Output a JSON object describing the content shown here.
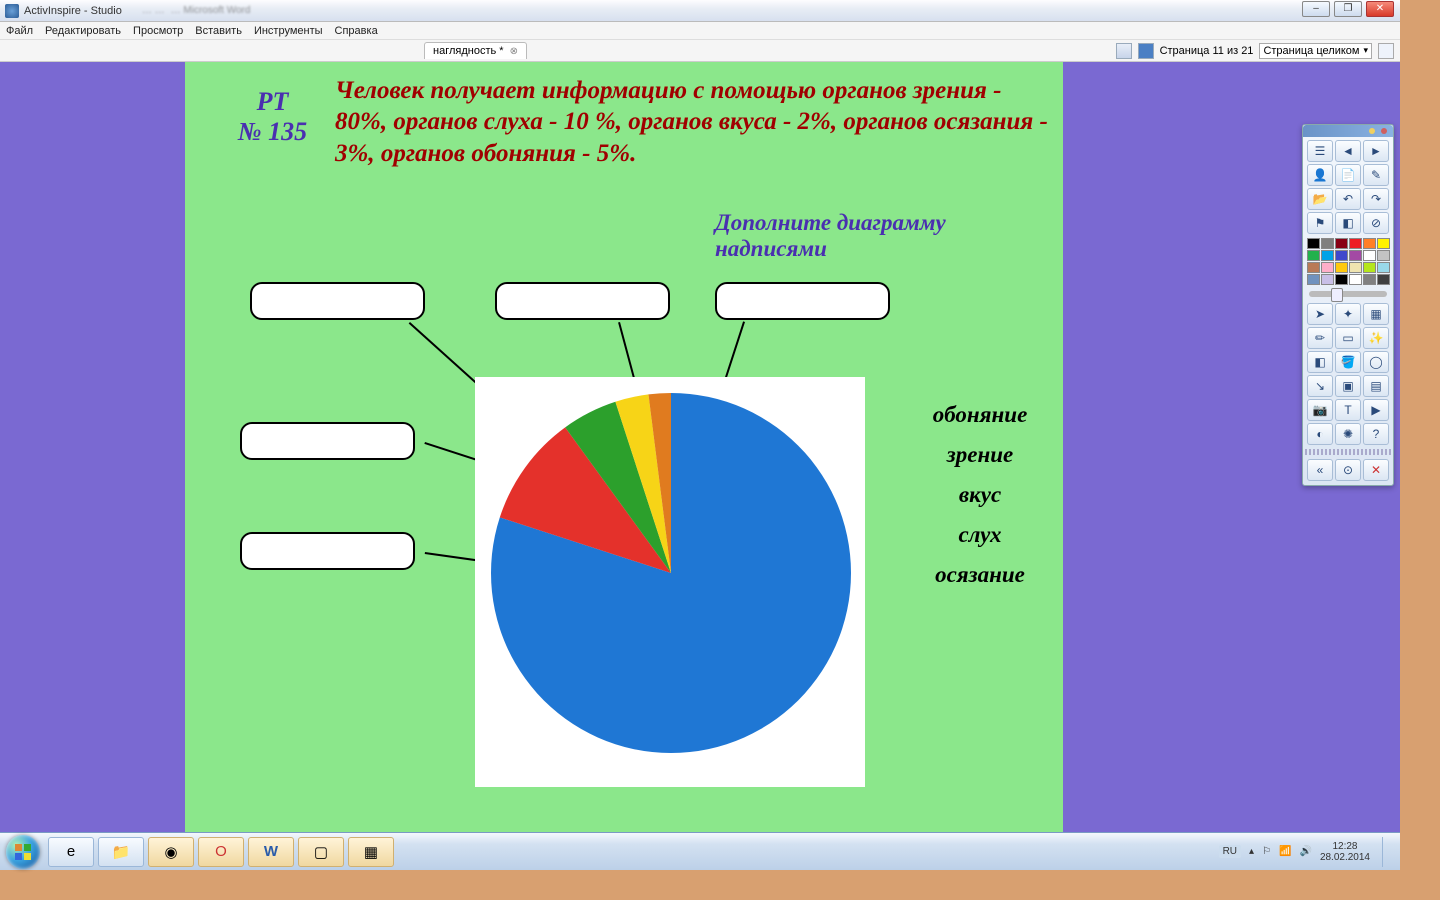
{
  "window": {
    "title": "ActivInspire - Studio",
    "min_label": "–",
    "max_label": "❐",
    "close_label": "✕"
  },
  "menu": {
    "file": "Файл",
    "edit": "Редактировать",
    "view": "Просмотр",
    "insert": "Вставить",
    "tools": "Инструменты",
    "help": "Справка"
  },
  "document": {
    "tab_name": "наглядность *",
    "page_counter": "Страница 11 из 21",
    "zoom_mode": "Страница целиком"
  },
  "slide": {
    "heading_line1": "РТ",
    "heading_line2": "№ 135",
    "body_text": "Человек получает информацию с помощью органов зрения - 80%, органов слуха - 10 %, органов вкуса - 2%, органов осязания - 3%, органов обоняния - 5%.",
    "instruction": "Дополните диаграмму надписями",
    "word_bank": [
      "обоняние",
      "зрение",
      "вкус",
      "слух",
      "осязание"
    ]
  },
  "chart_data": {
    "type": "pie",
    "title": "",
    "categories": [
      "зрение",
      "слух",
      "обоняние",
      "осязание",
      "вкус"
    ],
    "values": [
      80,
      10,
      5,
      3,
      2
    ],
    "colors": [
      "#1f77d4",
      "#e4312b",
      "#2ca02c",
      "#f7d417",
      "#e07b1f"
    ]
  },
  "palette_colors": [
    "#000000",
    "#7f7f7f",
    "#880015",
    "#ed1c24",
    "#ff7f27",
    "#fff200",
    "#22b14c",
    "#00a2e8",
    "#3f48cc",
    "#a349a4",
    "#ffffff",
    "#c3c3c3",
    "#b97a57",
    "#ffaec9",
    "#ffc90e",
    "#efe4b0",
    "#b5e61d",
    "#99d9ea",
    "#7092be",
    "#c8bfe7",
    "#000000",
    "#ffffff",
    "#808080",
    "#404040"
  ],
  "taskbar": {
    "lang": "RU",
    "time": "12:28",
    "date": "28.02.2014"
  }
}
